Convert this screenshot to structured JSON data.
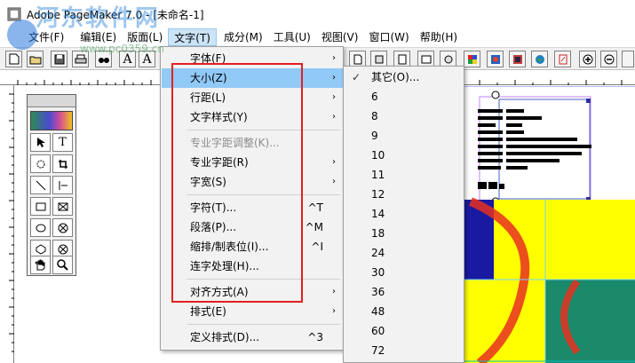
{
  "window": {
    "title": "Adobe PageMaker 7.0 - [未命名-1]"
  },
  "watermark": {
    "text": "河东软件网",
    "url": "www.pc0359.cn"
  },
  "menubar": {
    "items": [
      {
        "label": "文件(F)"
      },
      {
        "label": "编辑(E)"
      },
      {
        "label": "版面(L)"
      },
      {
        "label": "文字(T)"
      },
      {
        "label": "成分(M)"
      },
      {
        "label": "工具(U)"
      },
      {
        "label": "视图(V)"
      },
      {
        "label": "窗口(W)"
      },
      {
        "label": "帮助(H)"
      }
    ]
  },
  "text_menu": {
    "items": [
      {
        "label": "字体(F)",
        "shortcut": "",
        "submenu": true
      },
      {
        "label": "大小(Z)",
        "shortcut": "",
        "submenu": true,
        "highlighted": true
      },
      {
        "label": "行距(L)",
        "shortcut": "",
        "submenu": true
      },
      {
        "label": "文字样式(Y)",
        "shortcut": "",
        "submenu": true
      },
      {
        "label": "专业字距调整(K)...",
        "shortcut": "",
        "disabled": true
      },
      {
        "label": "专业字距(R)",
        "shortcut": "",
        "submenu": true
      },
      {
        "label": "字宽(S)",
        "shortcut": "",
        "submenu": true
      },
      {
        "label": "字符(T)...",
        "shortcut": "^T"
      },
      {
        "label": "段落(P)...",
        "shortcut": "^M"
      },
      {
        "label": "缩排/制表位(I)...",
        "shortcut": "^I"
      },
      {
        "label": "连字处理(H)...",
        "shortcut": ""
      },
      {
        "label": "对齐方式(A)",
        "shortcut": "",
        "submenu": true
      },
      {
        "label": "排式(E)",
        "shortcut": "",
        "submenu": true
      },
      {
        "label": "定义排式(D)...",
        "shortcut": "^3"
      }
    ]
  },
  "size_menu": {
    "items": [
      {
        "label": "其它(O)...",
        "checked": true
      },
      {
        "label": "6"
      },
      {
        "label": "8"
      },
      {
        "label": "9"
      },
      {
        "label": "10"
      },
      {
        "label": "11"
      },
      {
        "label": "12"
      },
      {
        "label": "14"
      },
      {
        "label": "18"
      },
      {
        "label": "24"
      },
      {
        "label": "30"
      },
      {
        "label": "36"
      },
      {
        "label": "48"
      },
      {
        "label": "60"
      },
      {
        "label": "72"
      }
    ]
  },
  "icons": {
    "check": "✓",
    "submenu_arrow": "›",
    "text_tool": "T",
    "pointer_tool": "pointer-arrow",
    "hand_tool": "hand",
    "zoom_tool": "magnifier"
  },
  "colors": {
    "highlight": "#91c9f7",
    "annotation_red": "#e32020",
    "doc_blue": "#1a1aa0",
    "doc_yellow": "#ffff00",
    "doc_green": "#1a8a6a",
    "doc_red": "#e83020"
  }
}
